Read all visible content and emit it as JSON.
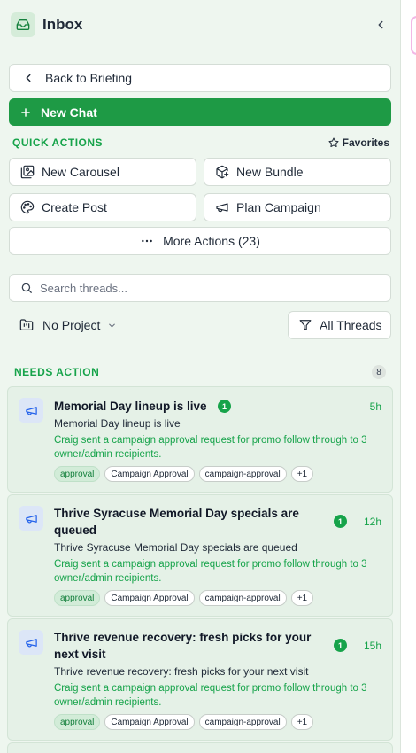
{
  "header": {
    "title": "Inbox",
    "inbox_icon": "inbox-icon",
    "collapse_icon": "chevron-left-icon"
  },
  "back_button": {
    "label": "Back to Briefing"
  },
  "new_chat": {
    "label": "New Chat",
    "color": "#1e9a45"
  },
  "quick_actions": {
    "label": "QUICK ACTIONS",
    "favorites_label": "Favorites",
    "items": [
      {
        "label": "New Carousel",
        "icon": "images-icon"
      },
      {
        "label": "New Bundle",
        "icon": "package-plus-icon"
      },
      {
        "label": "Create Post",
        "icon": "palette-icon"
      },
      {
        "label": "Plan Campaign",
        "icon": "megaphone-icon"
      }
    ],
    "more_label": "More Actions (23)"
  },
  "search": {
    "placeholder": "Search threads..."
  },
  "filters": {
    "project_label": "No Project",
    "threads_label": "All Threads"
  },
  "needs_action": {
    "label": "NEEDS ACTION",
    "count": "8",
    "threads": [
      {
        "title_line1": "Memorial Day lineup is live",
        "title_line2": "",
        "badge": "1",
        "time": "5h",
        "subtitle": "Memorial Day lineup is live",
        "description": "Craig sent a campaign approval request for promo follow through to 3 owner/admin recipients.",
        "tags": [
          "approval",
          "Campaign Approval",
          "campaign-approval",
          "+1"
        ]
      },
      {
        "title_line1": "Thrive Syracuse Memorial Day specials are",
        "title_line2": "queued",
        "badge": "1",
        "time": "12h",
        "subtitle": "Thrive Syracuse Memorial Day specials are queued",
        "description": "Craig sent a campaign approval request for promo follow through to 3 owner/admin recipients.",
        "tags": [
          "approval",
          "Campaign Approval",
          "campaign-approval",
          "+1"
        ]
      },
      {
        "title_line1": "Thrive revenue recovery: fresh picks for your",
        "title_line2": "next visit",
        "badge": "1",
        "time": "15h",
        "subtitle": "Thrive revenue recovery: fresh picks for your next visit",
        "description": "Craig sent a campaign approval request for promo follow through to 3 owner/admin recipients.",
        "tags": [
          "approval",
          "Campaign Approval",
          "campaign-approval",
          "+1"
        ]
      }
    ]
  },
  "colors": {
    "accent": "#16a34a",
    "panel_bg": "#eef6ef",
    "card_bg": "#e5f1e7",
    "icon_bg": "#dce6f7",
    "icon_fg": "#2563eb"
  }
}
